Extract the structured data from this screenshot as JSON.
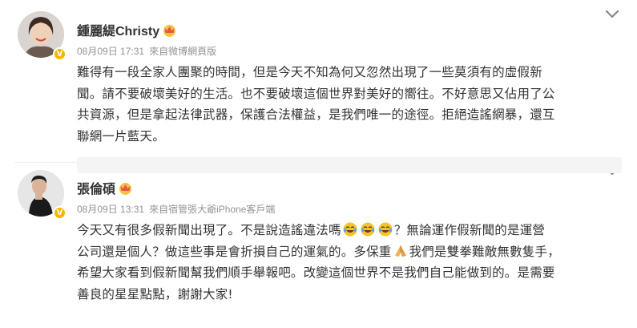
{
  "posts": [
    {
      "author": "鍾麗緹Christy",
      "date": "08月09日 17:31",
      "source": "來自微博網頁版",
      "lines": [
        "難得有一段全家人團聚的時間，但是今天不知為何又忽然出現了一些莫須有的虛假新",
        "聞。請不要破壞美好的生活。也不要破壞這個世界對美好的嚮往。不好意思又佔用了公",
        "共資源，但是拿起法律武器，保護合法權益，是我們唯一的途徑。拒絕造謠網暴，還互",
        "聯網一片藍天。"
      ]
    },
    {
      "author": "張倫碩",
      "date": "08月09日 13:31",
      "source": "來自宿管張大爺iPhone客戶端",
      "line1_before": "今天又有很多假新聞出現了。不是說造謠違法嗎",
      "line1_after": "？無論運作假新聞的是運營",
      "line2_before": "公司還是個人？做這些事是會折損自己的運氣的。多保重",
      "line2_after": "我們是雙拳難敵無數隻手，",
      "line3": "希望大家看到假新聞幫我們順手舉報吧。改變這個世界不是我們自己能做到的。是需要",
      "line4": "善良的星星點點，謝謝大家!"
    }
  ],
  "icons": {
    "crown": "crown-icon",
    "verified": "verified-badge-icon",
    "chevron": "chevron-down-icon",
    "laugh_cry": "laugh-cry-emoji-icon",
    "pray": "pray-emoji-icon"
  },
  "colors": {
    "verified": "#f7b500",
    "meta_text": "#939393",
    "body_text": "#333333",
    "crown": "#e8564a"
  }
}
